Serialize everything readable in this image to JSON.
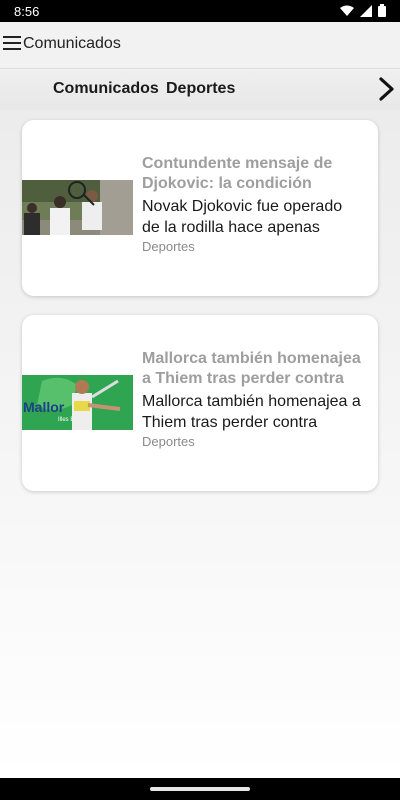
{
  "status_bar": {
    "time": "8:56"
  },
  "app_bar": {
    "title": "Comunicados",
    "menu_icon": "hamburger-menu-icon"
  },
  "tabs": [
    {
      "label": "Comunicados"
    },
    {
      "label": "Deportes"
    }
  ],
  "tab_next_icon": "chevron-right-icon",
  "articles": [
    {
      "title": "Contundente mensaje de Djokovic: la condición",
      "description": "Novak Djokovic fue operado de la rodilla hace apenas",
      "category": "Deportes",
      "image_text": ""
    },
    {
      "title": "Mallorca también homenajea a Thiem tras perder contra",
      "description": "Mallorca también homenajea a Thiem tras perder contra",
      "category": "Deportes",
      "image_text": "Mallor"
    }
  ]
}
